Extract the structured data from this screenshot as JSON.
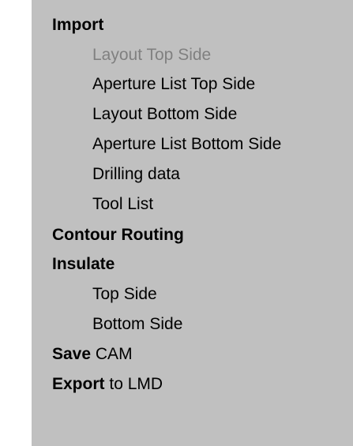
{
  "menu": {
    "import": {
      "label": "Import",
      "items": [
        {
          "label": "Layout Top Side",
          "enabled": false
        },
        {
          "label": "Aperture List Top Side",
          "enabled": true
        },
        {
          "label": "Layout Bottom Side",
          "enabled": true
        },
        {
          "label": "Aperture List Bottom Side",
          "enabled": true
        },
        {
          "label": "Drilling data",
          "enabled": true
        },
        {
          "label": "Tool List",
          "enabled": true
        }
      ]
    },
    "contour_routing": {
      "label": "Contour Routing"
    },
    "insulate": {
      "label": "Insulate",
      "items": [
        {
          "label": "Top Side"
        },
        {
          "label": "Bottom Side"
        }
      ]
    },
    "save": {
      "bold": "Save",
      "rest": "CAM"
    },
    "export": {
      "bold": "Export",
      "rest": "to LMD"
    }
  },
  "colors": {
    "panel_background": "#c0c0c0",
    "page_background": "#ffffff",
    "text": "#000000",
    "disabled_text": "#808080"
  }
}
